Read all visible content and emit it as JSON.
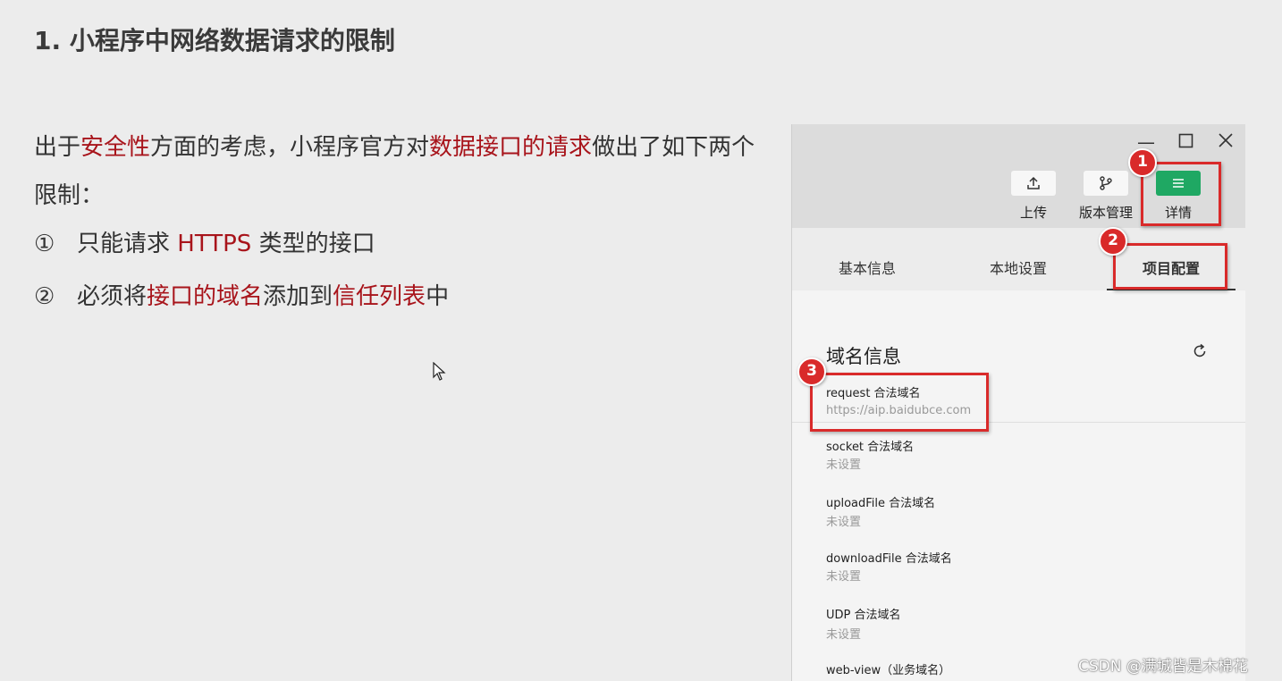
{
  "title": "1. 小程序中网络数据请求的限制",
  "intro": {
    "p1": "出于",
    "h1": "安全性",
    "p2": "方面的考虑，小程序官方对",
    "h2": "数据接口的请求",
    "p3": "做出了如下两个限制："
  },
  "list": [
    {
      "num": "①",
      "a": "只能请求 ",
      "b": "HTTPS",
      "c": " 类型的接口",
      "d": "",
      "e": ""
    },
    {
      "num": "②",
      "a": "必须将",
      "b": "接口的域名",
      "c": "添加到",
      "d": "信任列表",
      "e": "中"
    }
  ],
  "toolbar": {
    "upload": "上传",
    "version": "版本管理",
    "details": "详情"
  },
  "tabs": [
    "基本信息",
    "本地设置",
    "项目配置"
  ],
  "section_title": "域名信息",
  "domains": [
    {
      "label": "request 合法域名",
      "value": "https://aip.baidubce.com"
    },
    {
      "label": "socket 合法域名",
      "value": "未设置"
    },
    {
      "label": "uploadFile 合法域名",
      "value": "未设置"
    },
    {
      "label": "downloadFile 合法域名",
      "value": "未设置"
    },
    {
      "label": "UDP 合法域名",
      "value": "未设置"
    },
    {
      "label": "web-view（业务域名）",
      "value": ""
    }
  ],
  "badges": [
    "1",
    "2",
    "3"
  ],
  "watermark": "CSDN @满城皆是木棉花",
  "colors": {
    "highlight": "#a8141b",
    "annotation": "#d92a2a",
    "details_button": "#1fa863"
  }
}
